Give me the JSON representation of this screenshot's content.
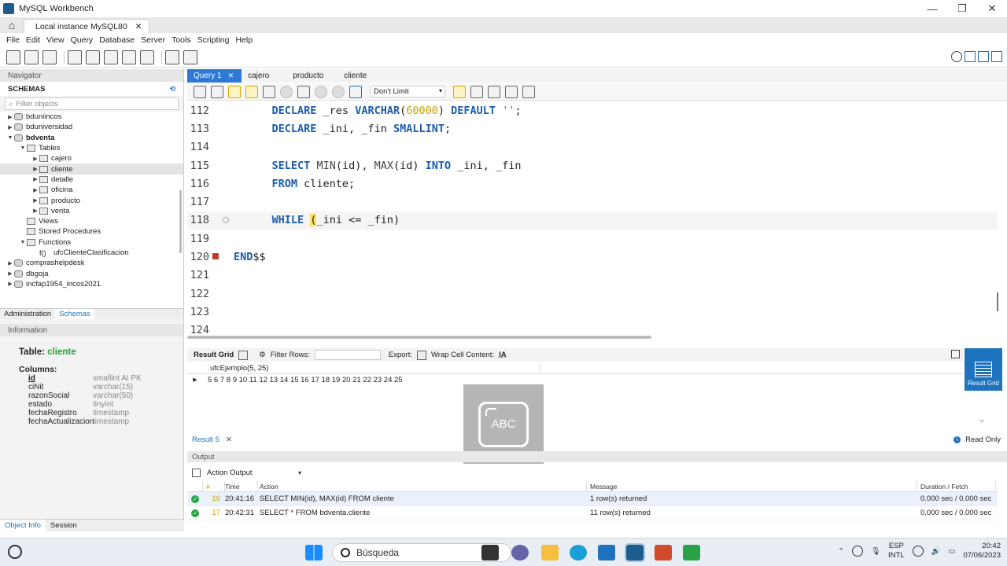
{
  "window": {
    "title": "MySQL Workbench",
    "minimize": "—",
    "maximize": "❐",
    "close": "✕"
  },
  "connection_tab": {
    "label": "Local instance MySQL80",
    "close": "✕"
  },
  "menu": [
    "File",
    "Edit",
    "View",
    "Query",
    "Database",
    "Server",
    "Tools",
    "Scripting",
    "Help"
  ],
  "navigator": {
    "header": "Navigator",
    "schemas_label": "SCHEMAS",
    "filter_placeholder": "Filter objects",
    "tree": [
      {
        "label": "bduniincos",
        "level": 0,
        "arrow": "▶",
        "icon": "db"
      },
      {
        "label": "bduniversidad",
        "level": 0,
        "arrow": "▶",
        "icon": "db"
      },
      {
        "label": "bdventa",
        "level": 0,
        "arrow": "▼",
        "icon": "db",
        "bold": true
      },
      {
        "label": "Tables",
        "level": 1,
        "arrow": "▼",
        "icon": "folder"
      },
      {
        "label": "cajero",
        "level": 2,
        "arrow": "▶",
        "icon": "table"
      },
      {
        "label": "cliente",
        "level": 2,
        "arrow": "▶",
        "icon": "table",
        "selected": true
      },
      {
        "label": "detalle",
        "level": 2,
        "arrow": "▶",
        "icon": "table"
      },
      {
        "label": "oficina",
        "level": 2,
        "arrow": "▶",
        "icon": "table"
      },
      {
        "label": "producto",
        "level": 2,
        "arrow": "▶",
        "icon": "table"
      },
      {
        "label": "venta",
        "level": 2,
        "arrow": "▶",
        "icon": "table"
      },
      {
        "label": "Views",
        "level": 1,
        "arrow": "",
        "icon": "folder"
      },
      {
        "label": "Stored Procedures",
        "level": 1,
        "arrow": "",
        "icon": "folder"
      },
      {
        "label": "Functions",
        "level": 1,
        "arrow": "▼",
        "icon": "folder"
      },
      {
        "label": "ufcClienteClasificacion",
        "level": 2,
        "arrow": "",
        "icon": "fn"
      },
      {
        "label": "comprashelpdesk",
        "level": 0,
        "arrow": "▶",
        "icon": "db"
      },
      {
        "label": "dbgoja",
        "level": 0,
        "arrow": "▶",
        "icon": "db"
      },
      {
        "label": "incfap1954_incos2021",
        "level": 0,
        "arrow": "▶",
        "icon": "db"
      }
    ],
    "tabs": [
      "Administration",
      "Schemas"
    ],
    "function_icon": "f()"
  },
  "information": {
    "header": "Information",
    "table_label": "Table:",
    "table_name": "cliente",
    "columns_label": "Columns:",
    "columns": [
      {
        "name": "id",
        "type": "smallint AI PK",
        "pk": true
      },
      {
        "name": "ciNit",
        "type": "varchar(15)"
      },
      {
        "name": "razonSocial",
        "type": "varchar(50)"
      },
      {
        "name": "estado",
        "type": "tinyint"
      },
      {
        "name": "fechaRegistro",
        "type": "timestamp"
      },
      {
        "name": "fechaActualizacion",
        "type": "timestamp"
      }
    ],
    "bottom_tabs": [
      "Object Info",
      "Session"
    ]
  },
  "query_tabs": [
    {
      "label": "Query 1",
      "active": true,
      "close": "✕"
    },
    {
      "label": "cajero"
    },
    {
      "label": "producto"
    },
    {
      "label": "cliente"
    }
  ],
  "editor_toolbar": {
    "limit": "Don't Limit"
  },
  "editor": {
    "lines": [
      {
        "n": "112",
        "code": "    DECLARE _res VARCHAR(60000) DEFAULT '';"
      },
      {
        "n": "113",
        "code": "    DECLARE _ini, _fin SMALLINT;"
      },
      {
        "n": "114",
        "code": ""
      },
      {
        "n": "115",
        "code": "    SELECT MIN(id), MAX(id) INTO _ini, _fin"
      },
      {
        "n": "116",
        "code": "    FROM cliente;"
      },
      {
        "n": "117",
        "code": ""
      },
      {
        "n": "118",
        "code": "    WHILE (_ini <= _fin)",
        "current": true
      },
      {
        "n": "119",
        "code": ""
      },
      {
        "n": "120",
        "code": "END$$",
        "error": true
      },
      {
        "n": "121",
        "code": ""
      },
      {
        "n": "122",
        "code": ""
      },
      {
        "n": "123",
        "code": ""
      },
      {
        "n": "124",
        "code": ""
      }
    ]
  },
  "result_toolbar": {
    "result_grid": "Result Grid",
    "filter_rows": "Filter Rows:",
    "export": "Export:",
    "wrap": "Wrap Cell Content:"
  },
  "result_grid": {
    "column": "ufcEjemplo(5, 25)",
    "row_value": "5 6 7 8 9 10 11 12 13 14 15 16 17 18 19 20 21 22 23 24 25"
  },
  "result_side_button": "Result Grid",
  "result_tab": {
    "label": "Result 5",
    "close": "✕",
    "read_only": "Read Only"
  },
  "overlay": {
    "text": "ABC"
  },
  "output": {
    "header": "Output",
    "selector": "Action Output",
    "columns": [
      "#",
      "Time",
      "Action",
      "Message",
      "Duration / Fetch"
    ],
    "rows": [
      {
        "num": "16",
        "time": "20:41:16",
        "action": "SELECT MIN(id), MAX(id) FROM cliente",
        "message": "1 row(s) returned",
        "duration": "0.000 sec / 0.000 sec"
      },
      {
        "num": "17",
        "time": "20:42:31",
        "action": "SELECT * FROM bdventa.cliente",
        "message": "11 row(s) returned",
        "duration": "0.000 sec / 0.000 sec"
      }
    ]
  },
  "taskbar": {
    "search": "Búsqueda",
    "lang_top": "ESP",
    "lang_bottom": "INTL",
    "time": "20:42",
    "date": "07/06/2023"
  }
}
